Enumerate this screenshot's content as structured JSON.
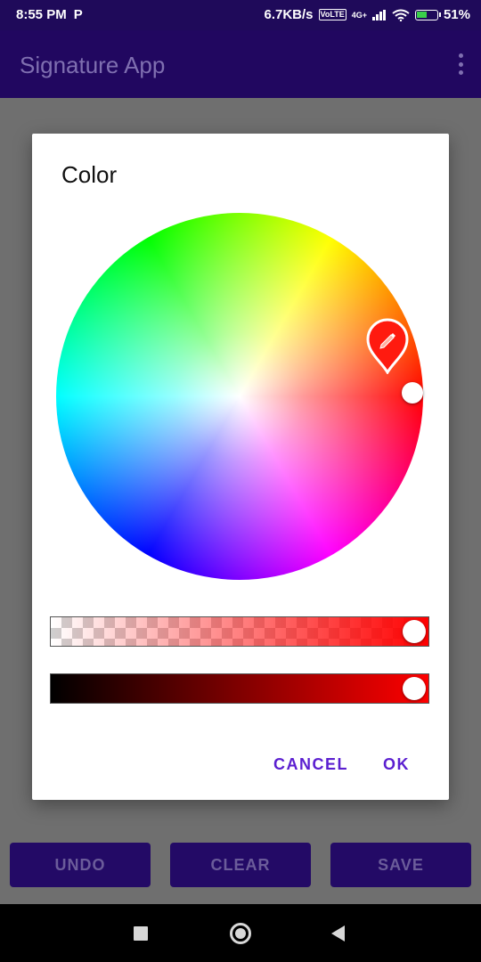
{
  "status_bar": {
    "time": "8:55 PM",
    "app_icon_glyph": "P",
    "net_speed": "6.7KB/s",
    "volte_label": "Vo LTE",
    "network_type": "4G+",
    "battery": "51%",
    "icons": [
      "parking-app-icon",
      "volte-icon",
      "signal-icon",
      "wifi-icon",
      "battery-charging-icon"
    ]
  },
  "app_bar": {
    "title": "Signature App",
    "overflow_icon": "more-vert-icon"
  },
  "dialog": {
    "title": "Color",
    "selected_color": "#ff0000",
    "alpha_value": 1.0,
    "value_level": 1.0,
    "cancel_label": "CANCEL",
    "ok_label": "OK",
    "accent_color": "#5b1fd0"
  },
  "actions": {
    "undo_label": "UNDO",
    "clear_label": "CLEAR",
    "save_label": "SAVE"
  },
  "nav_bar": {
    "icons": [
      "recents-square-icon",
      "home-circle-icon",
      "back-triangle-icon"
    ]
  }
}
